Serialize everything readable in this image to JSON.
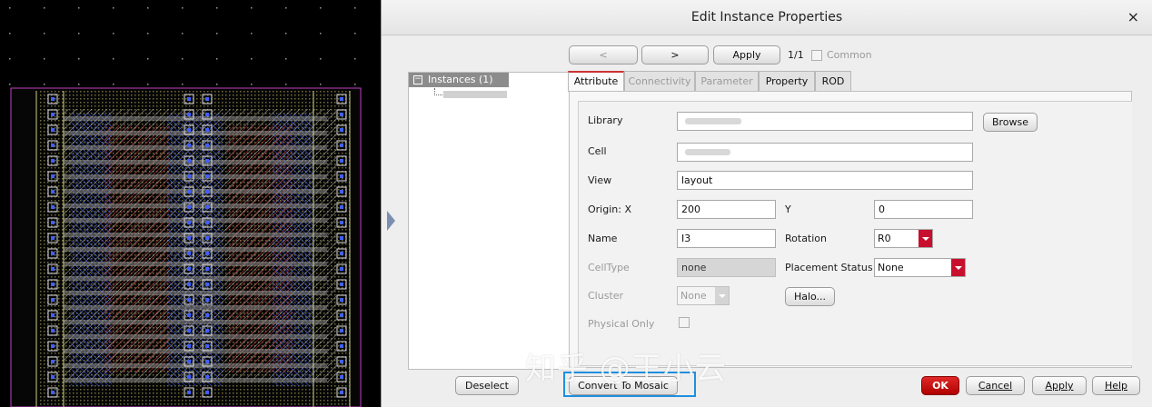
{
  "dialog": {
    "title": "Edit Instance Properties",
    "close_glyph": "×",
    "nav": {
      "prev": "<",
      "next": ">",
      "apply": "Apply",
      "page": "1/1",
      "common": "Common"
    },
    "tree": {
      "root": "Instances (1)"
    },
    "tabs": [
      "Attribute",
      "Connectivity",
      "Parameter",
      "Property",
      "ROD"
    ],
    "active_tab": "Attribute",
    "form": {
      "library_label": "Library",
      "browse": "Browse",
      "cell_label": "Cell",
      "view_label": "View",
      "view_value": "layout",
      "origin_x_label": "Origin: X",
      "origin_x": "200",
      "y_label": "Y",
      "y": "0",
      "name_label": "Name",
      "name": "I3",
      "rotation_label": "Rotation",
      "rotation": "R0",
      "celltype_label": "CellType",
      "celltype": "none",
      "placement_label": "Placement Status",
      "placement": "None",
      "cluster_label": "Cluster",
      "cluster": "None",
      "halo": "Halo...",
      "physical_only_label": "Physical Only"
    },
    "footer": {
      "deselect": "Deselect",
      "convert": "Convert To Mosaic",
      "ok": "OK",
      "cancel": "Cancel",
      "apply": "Apply",
      "help": "Help"
    }
  },
  "watermark": "知乎 @王小云",
  "colors": {
    "highlight": "#1e8fe0",
    "ok_button": "#c8102e",
    "canvas": "#000000"
  }
}
